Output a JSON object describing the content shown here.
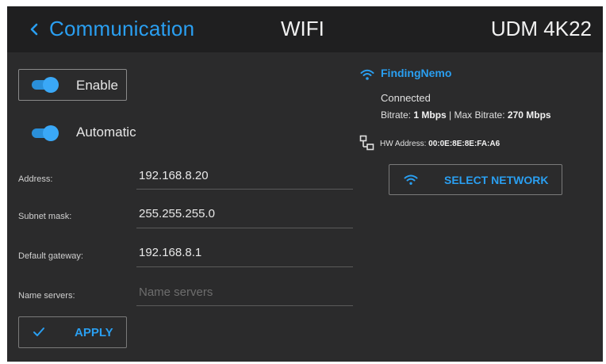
{
  "header": {
    "back_label": "Communication",
    "title": "WIFI",
    "device": "UDM 4K22"
  },
  "enable": {
    "label": "Enable",
    "on": true
  },
  "automatic": {
    "label": "Automatic",
    "on": true
  },
  "fields": {
    "address": {
      "label": "Address:",
      "value": "192.168.8.20"
    },
    "subnet": {
      "label": "Subnet mask:",
      "value": "255.255.255.0"
    },
    "gateway": {
      "label": "Default gateway:",
      "value": "192.168.8.1"
    },
    "dns": {
      "label": "Name servers:",
      "placeholder": "Name servers"
    }
  },
  "apply": {
    "label": "APPLY"
  },
  "network": {
    "ssid": "FindingNemo",
    "status": "Connected",
    "bitrate_label": "Bitrate:",
    "bitrate_value": "1 Mbps",
    "separator": "|",
    "max_bitrate_label": "Max Bitrate:",
    "max_bitrate_value": "270 Mbps",
    "hw_address_label": "HW Address:",
    "hw_address_value": "00:0E:8E:8E:FA:A6"
  },
  "select_network": {
    "label": "SELECT NETWORK"
  },
  "icons": {
    "back": "chevron-left-icon",
    "wifi": "wifi-icon",
    "hw": "network-adapter-icon",
    "check": "checkmark-icon"
  },
  "colors": {
    "accent": "#2a9ff1",
    "background": "#2b2b2c",
    "header_background": "#1f1f20",
    "text": "#e6e6e6"
  }
}
